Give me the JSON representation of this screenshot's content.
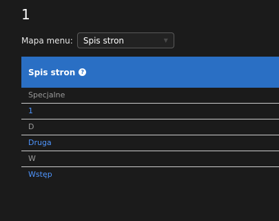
{
  "page": {
    "title": "1"
  },
  "map_menu": {
    "label": "Mapa menu:",
    "selected": "Spis stron"
  },
  "panel": {
    "title": "Spis stron",
    "help_icon": "help-circle-icon",
    "items": [
      {
        "label": "Specjalne",
        "style": "muted"
      },
      {
        "label": "1",
        "style": "link"
      },
      {
        "label": "D",
        "style": "muted"
      },
      {
        "label": "Druga",
        "style": "link"
      },
      {
        "label": "W",
        "style": "muted"
      },
      {
        "label": "Wstęp",
        "style": "link"
      }
    ]
  },
  "colors": {
    "accent": "#2a6fc4",
    "link": "#4f96ff",
    "background": "#1b1b1b"
  }
}
